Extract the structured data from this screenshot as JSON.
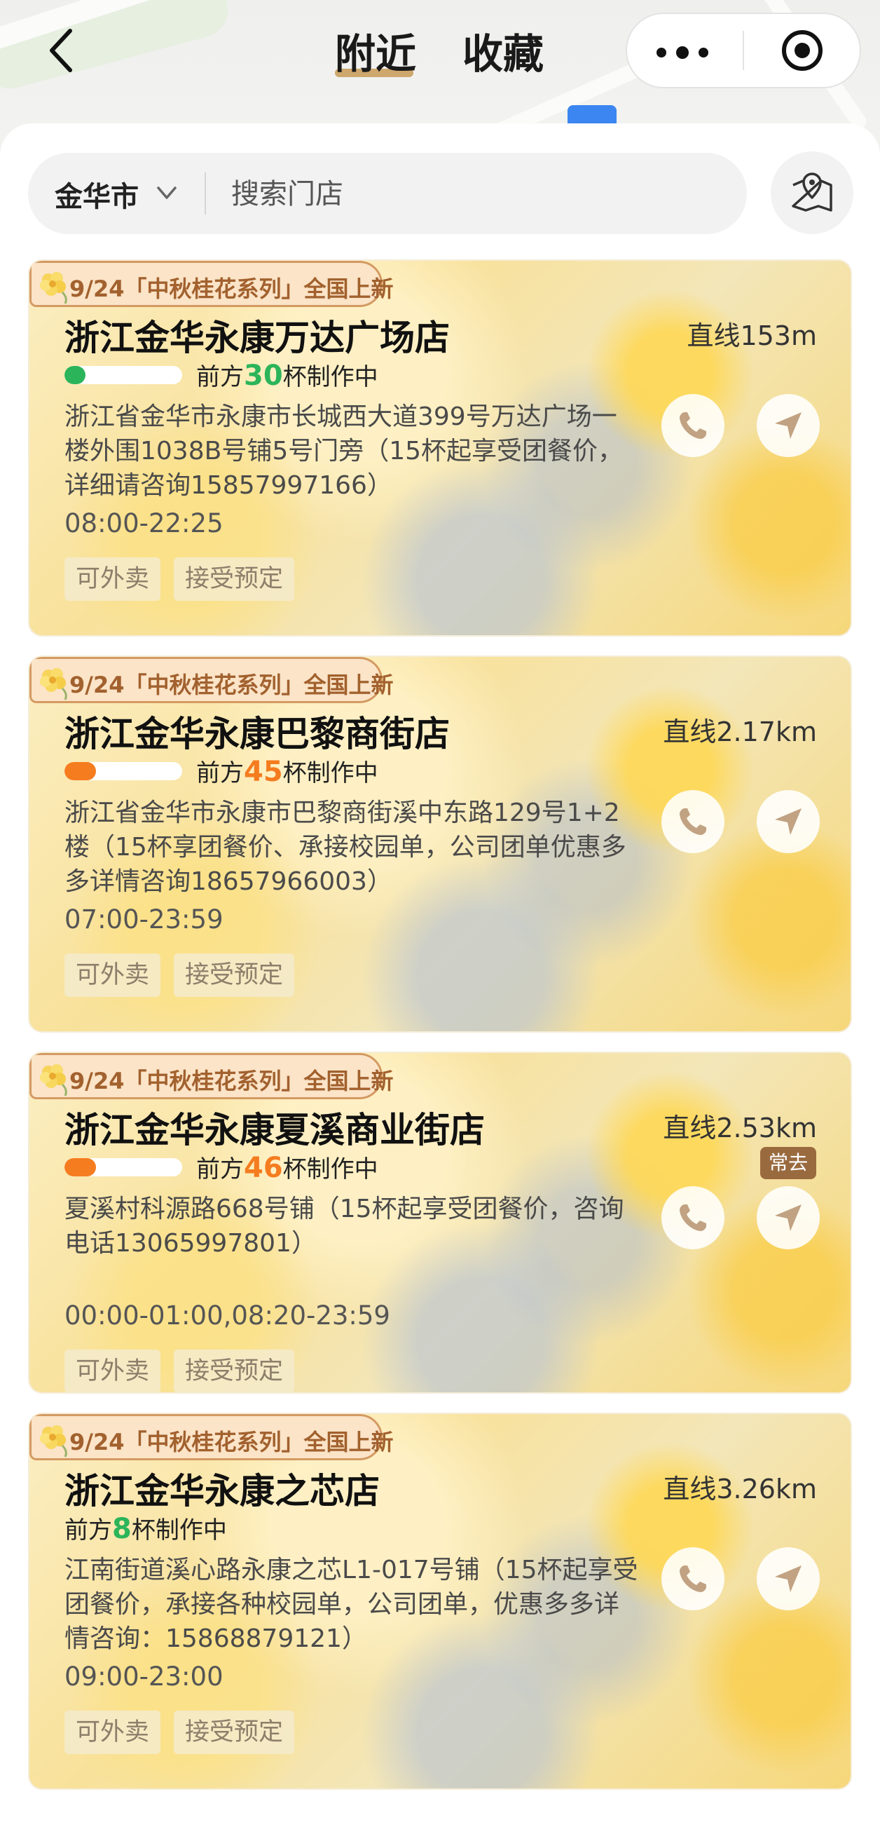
{
  "header": {
    "tabs": [
      {
        "label": "附近",
        "active": true
      },
      {
        "label": "收藏",
        "active": false
      }
    ]
  },
  "search": {
    "city": "金华市",
    "placeholder": "搜索门店"
  },
  "promo_badge": "9/24「中秋桂花系列」全国上新",
  "tag_labels": {
    "delivery": "可外卖",
    "reservation": "接受预定"
  },
  "queue_text": {
    "prefix": "前方",
    "suffix": "杯制作中"
  },
  "frequent_label": "常去",
  "colors": {
    "accent_gold": "#c79a55",
    "queue_green": "#2cb45a",
    "queue_orange": "#f57c1f",
    "badge_text": "#a2612e"
  },
  "stores": [
    {
      "name": "浙江金华永康万达广场店",
      "distance": "直线153m",
      "queue_count": "30",
      "queue_level": "low",
      "queue_fill": 0.18,
      "address": "浙江省金华市永康市长城西大道399号万达广场一楼外围1038B号铺5号门旁（15杯起享受团餐价，详细请咨询15857997166）",
      "hours": "08:00-22:25"
    },
    {
      "name": "浙江金华永康巴黎商街店",
      "distance": "直线2.17km",
      "queue_count": "45",
      "queue_level": "medium",
      "queue_fill": 0.27,
      "address": "浙江省金华市永康市巴黎商街溪中东路129号1+2楼（15杯享团餐价、承接校园单，公司团单优惠多多详情咨询18657966003）",
      "hours": "07:00-23:59"
    },
    {
      "name": "浙江金华永康夏溪商业街店",
      "distance": "直线2.53km",
      "queue_count": "46",
      "queue_level": "medium",
      "queue_fill": 0.27,
      "address": "夏溪村科源路668号铺（15杯起享受团餐价，咨询电话13065997801）",
      "hours": "00:00-01:00,08:20-23:59",
      "frequent": true
    },
    {
      "name": "浙江金华永康之芯店",
      "distance": "直线3.26km",
      "queue_count": "8",
      "queue_level": "low",
      "address": "江南街道溪心路永康之芯L1-017号铺（15杯起享受团餐价，承接各种校园单，公司团单，优惠多多详情咨询：15868879121）",
      "hours": "09:00-23:00"
    }
  ]
}
